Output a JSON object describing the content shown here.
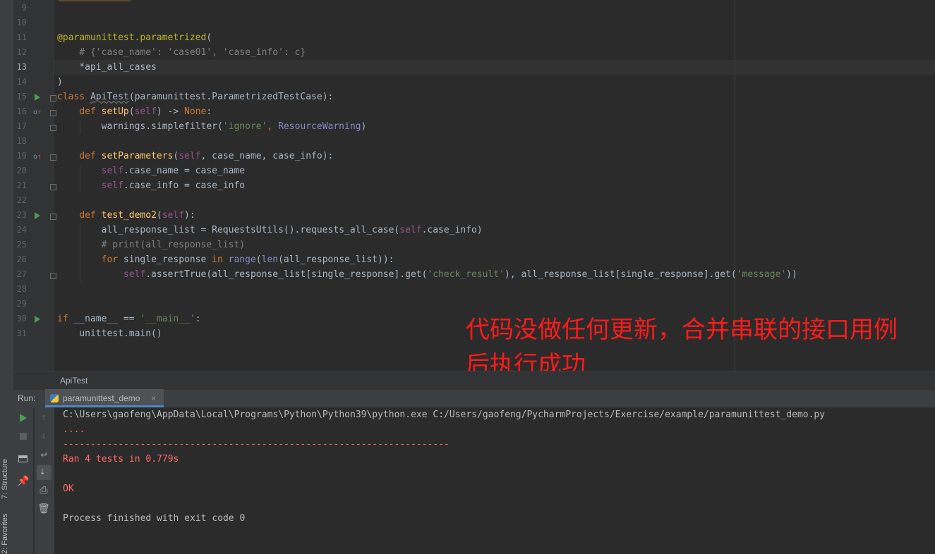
{
  "sidebar_tabs": {
    "structure": "7: Structure",
    "favorites": "2: Favorites"
  },
  "editor": {
    "line_numbers": [
      "9",
      "10",
      "11",
      "12",
      "13",
      "14",
      "15",
      "16",
      "17",
      "18",
      "19",
      "20",
      "21",
      "22",
      "23",
      "24",
      "25",
      "26",
      "27",
      "28",
      "29",
      "30",
      "31"
    ],
    "lines": {
      "l11_dec": "@paramunittest.parametrized",
      "l11_rest": "(",
      "l12": "    # {'case_name': 'case01', 'case_info': c}",
      "l13": "    *api_all_cases",
      "l14": ")",
      "l15_kw": "class ",
      "l15_name": "ApiTest",
      "l15_rest": "(paramunittest.ParametrizedTestCase):",
      "l16_ind": "    ",
      "l16_kw": "def ",
      "l16_fn": "setUp",
      "l16_p1": "(",
      "l16_self": "self",
      "l16_p2": ") -> ",
      "l16_none": "None",
      "l16_p3": ":",
      "l17_a": "        warnings.simplefilter(",
      "l17_str": "'ignore'",
      "l17_b": ", ",
      "l17_cls": "ResourceWarning",
      "l17_c": ")",
      "l19_ind": "    ",
      "l19_kw": "def ",
      "l19_fn": "setParameters",
      "l19_p1": "(",
      "l19_self": "self",
      "l19_p2": ", case_name, case_info):",
      "l20_ind": "        ",
      "l20_self": "self",
      "l20_rest": ".case_name = case_name",
      "l21_ind": "        ",
      "l21_self": "self",
      "l21_rest": ".case_info = case_info",
      "l23_ind": "    ",
      "l23_kw": "def ",
      "l23_fn": "test_demo2",
      "l23_p1": "(",
      "l23_self": "self",
      "l23_p2": "):",
      "l24_a": "        all_response_list = RequestsUtils().requests_all_case(",
      "l24_self": "self",
      "l24_b": ".case_info)",
      "l25": "        # print(all_response_list)",
      "l26_ind": "        ",
      "l26_for": "for",
      "l26_a": " single_response ",
      "l26_in": "in",
      "l26_sp": " ",
      "l26_range": "range",
      "l26_p": "(",
      "l26_len": "len",
      "l26_b": "(all_response_list)):",
      "l27_ind": "            ",
      "l27_self": "self",
      "l27_a": ".assertTrue(all_response_list[single_response].get(",
      "l27_str1": "'check_result'",
      "l27_b": "), all_response_list[single_response].get(",
      "l27_str2": "'message'",
      "l27_c": "))",
      "l30_kw": "if ",
      "l30_a": "__name__ == ",
      "l30_str": "'__main__'",
      "l30_b": ":",
      "l31": "    unittest.main()"
    }
  },
  "annotation": {
    "line1": "代码没做任何更新，合并串联的接口用例",
    "line2": "后执行成功"
  },
  "breadcrumb": "ApiTest",
  "run_panel": {
    "label": "Run:",
    "tab_label": "paramunittest_demo",
    "tab_close": "×",
    "console": {
      "cmd": "C:\\Users\\gaofeng\\AppData\\Local\\Programs\\Python\\Python39\\python.exe C:/Users/gaofeng/PycharmProjects/Exercise/example/paramunittest_demo.py",
      "dots": "....",
      "separator": "----------------------------------------------------------------------",
      "ran": "Ran 4 tests in 0.779s",
      "ok": "OK",
      "exit": "Process finished with exit code 0"
    }
  },
  "colors": {
    "stderr": "#ff6b68",
    "stdout": "#bbbbbb",
    "run_green": "#499c54",
    "annotation_red": "#ff1a1a"
  },
  "icons": [
    "run-icon",
    "stop-icon",
    "layout-icon",
    "pin-icon",
    "up-arrow-icon",
    "down-arrow-icon",
    "soft-wrap-icon",
    "scroll-to-end-icon",
    "print-icon",
    "trash-icon",
    "python-file-icon",
    "override-icon"
  ]
}
